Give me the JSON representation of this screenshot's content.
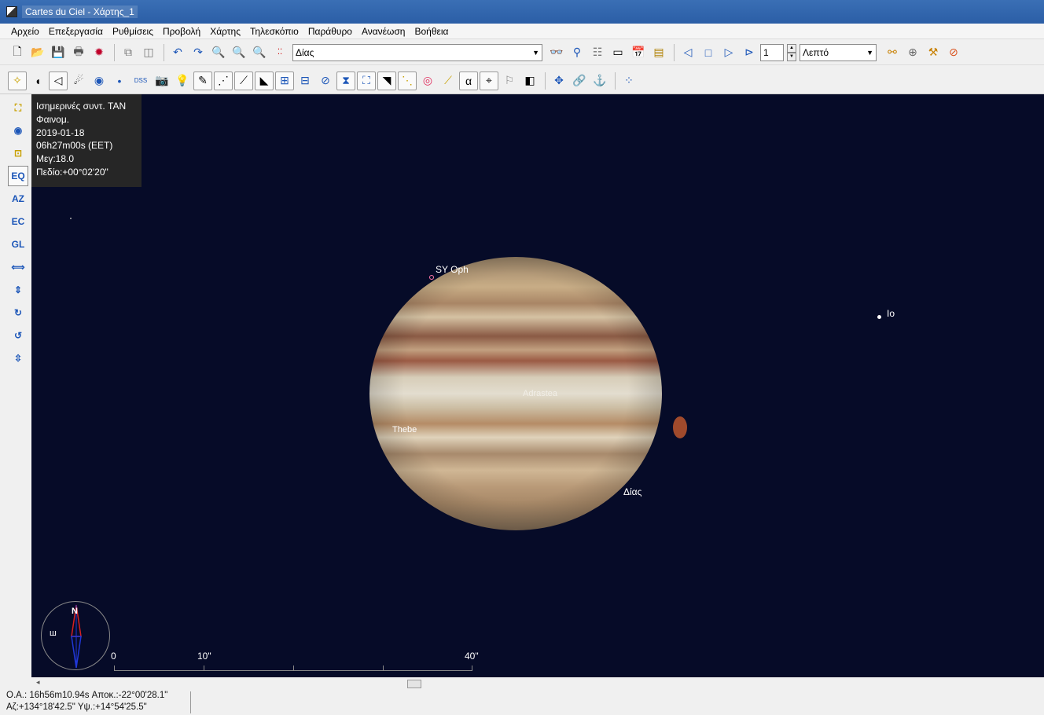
{
  "window": {
    "title": "Cartes du Ciel - Χάρτης_1"
  },
  "menu": [
    "Αρχείο",
    "Επεξεργασία",
    "Ρυθμίσεις",
    "Προβολή",
    "Χάρτης",
    "Τηλεσκόπιο",
    "Παράθυρο",
    "Ανανέωση",
    "Βοήθεια"
  ],
  "toolbar": {
    "search_value": "Δίας",
    "step_value": "1",
    "time_unit": "Λεπτό",
    "dss_label": "DSS",
    "alpha_label": "α"
  },
  "lefttoolbar": {
    "eq_label": "EQ",
    "az_label": "AZ",
    "ec_label": "EC",
    "gl_label": "GL"
  },
  "info": {
    "lines": [
      "Ισημερινές συντ. TAN",
      "Φαινομ.",
      "2019-01-18",
      "06h27m00s (EET)",
      "Μεγ:18.0",
      "Πεδίο:+00°02'20\""
    ]
  },
  "sky": {
    "labels": {
      "star": "SY Oph",
      "moon_io": "Io",
      "moon_thebe": "Thebe",
      "planet": "Δίας",
      "adrastea": "Adrastea"
    }
  },
  "compass": {
    "north": "N",
    "west": "ш"
  },
  "scale": {
    "ticks": [
      "0",
      "10\"",
      "40\""
    ]
  },
  "status": {
    "line1": "Ο.Α.: 16h56m10.94s Αποκ.:-22°00'28.1\"",
    "line2": "Αζ:+134°18'42.5\" Υψ.:+14°54'25.5\""
  }
}
